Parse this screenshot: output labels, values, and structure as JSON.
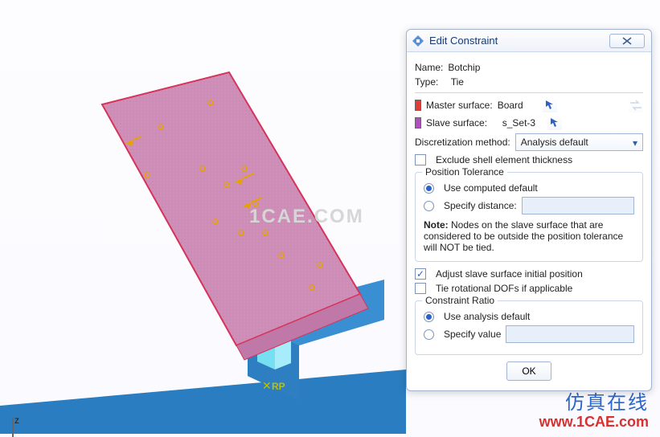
{
  "dialog": {
    "title": "Edit Constraint",
    "name_label": "Name:",
    "name_value": "Botchip",
    "type_label": "Type:",
    "type_value": "Tie",
    "master_label": "Master surface:",
    "master_value": "Board",
    "slave_label": "Slave surface:",
    "slave_value": "s_Set-3",
    "discret_label": "Discretization method:",
    "discret_value": "Analysis default",
    "exclude_label": "Exclude shell element thickness",
    "position_group": "Position Tolerance",
    "pos_opt1": "Use computed default",
    "pos_opt2": "Specify distance:",
    "note_label": "Note:",
    "note_text": "Nodes on the slave surface that are considered to be outside the position tolerance will NOT be tied.",
    "adjust_label": "Adjust slave surface initial position",
    "tierot_label": "Tie rotational DOFs if applicable",
    "ratio_group": "Constraint Ratio",
    "ratio_opt1": "Use analysis default",
    "ratio_opt2": "Specify value",
    "ok_label": "OK"
  },
  "canvas": {
    "rp_label": "RP",
    "axis_z": "z",
    "watermark": "1CAE.COM",
    "brand_cn": "仿真在线",
    "brand_url": "www.1CAE.com"
  }
}
